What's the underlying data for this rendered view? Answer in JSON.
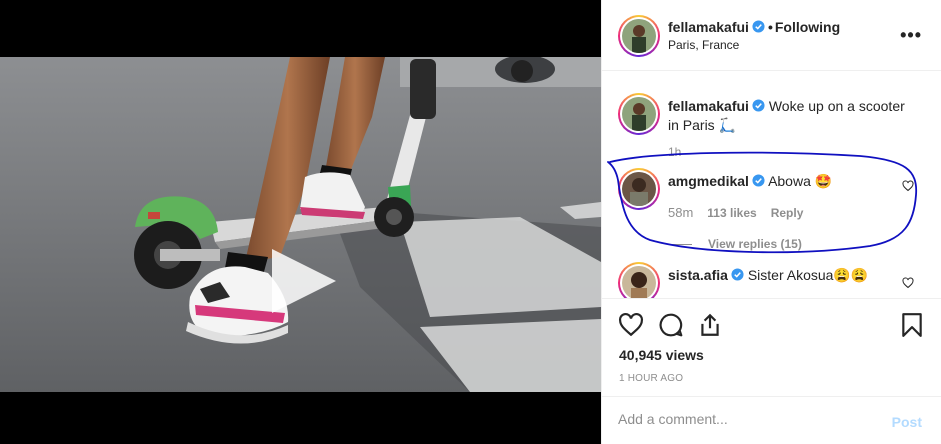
{
  "post": {
    "author": "fellamakafui",
    "follow_status": "Following",
    "separator": "•",
    "location": "Paris, France",
    "more_label": "•••",
    "caption": "Woke up on a scooter in Paris 🛴",
    "caption_time": "1h"
  },
  "comments": [
    {
      "user": "amgmedikal",
      "verified": true,
      "text": "Abowa 🤩",
      "time": "58m",
      "likes": "113 likes",
      "reply": "Reply",
      "view_replies": "View replies (15)"
    },
    {
      "user": "sista.afia",
      "verified": true,
      "text": "Sister Akosua😩😩"
    }
  ],
  "stats": {
    "views": "40,945 views",
    "posted": "1 HOUR AGO"
  },
  "composer": {
    "placeholder": "Add a comment...",
    "post_label": "Post"
  },
  "icons": {
    "like": "heart-icon",
    "comment": "comment-icon",
    "share": "share-icon",
    "save": "bookmark-icon",
    "verified": "verified-badge-icon",
    "play": "play-icon",
    "more": "more-options-icon"
  },
  "colors": {
    "verified": "#3897f0",
    "post_disabled": "#b3dbff",
    "annotation": "#1010c0",
    "scooter_green": "#3aa655"
  }
}
